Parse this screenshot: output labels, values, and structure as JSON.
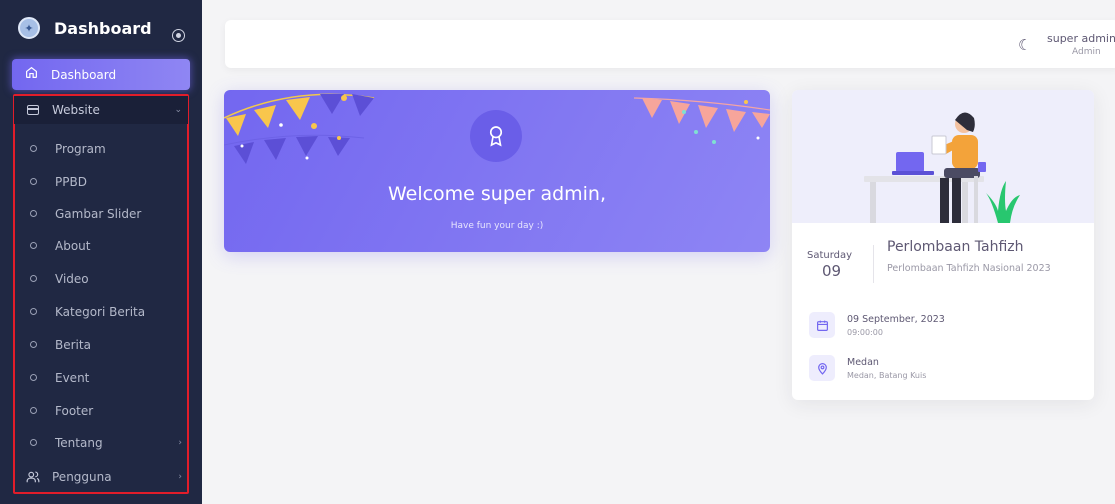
{
  "sidebar": {
    "brand": "Dashboard",
    "active_item": "Dashboard",
    "website_group": "Website",
    "submenu": [
      "Program",
      "PPBD",
      "Gambar Slider",
      "About",
      "Video",
      "Kategori Berita",
      "Berita",
      "Event",
      "Footer",
      "Tentang"
    ],
    "pengguna": "Pengguna"
  },
  "header": {
    "user_name": "super admin",
    "user_role": "Admin"
  },
  "welcome": {
    "title": "Welcome super admin,",
    "subtitle": "Have fun your day :)"
  },
  "event": {
    "day_name": "Saturday",
    "day_number": "09",
    "title": "Perlombaan Tahfizh",
    "description": "Perlombaan Tahfizh Nasional 2023",
    "date": "09 September, 2023",
    "time": "09:00:00",
    "location": "Medan",
    "address": "Medan, Batang Kuis"
  },
  "colors": {
    "sidebar_bg": "#202843",
    "primary": "#7367f0",
    "highlight": "#e11d2a"
  }
}
